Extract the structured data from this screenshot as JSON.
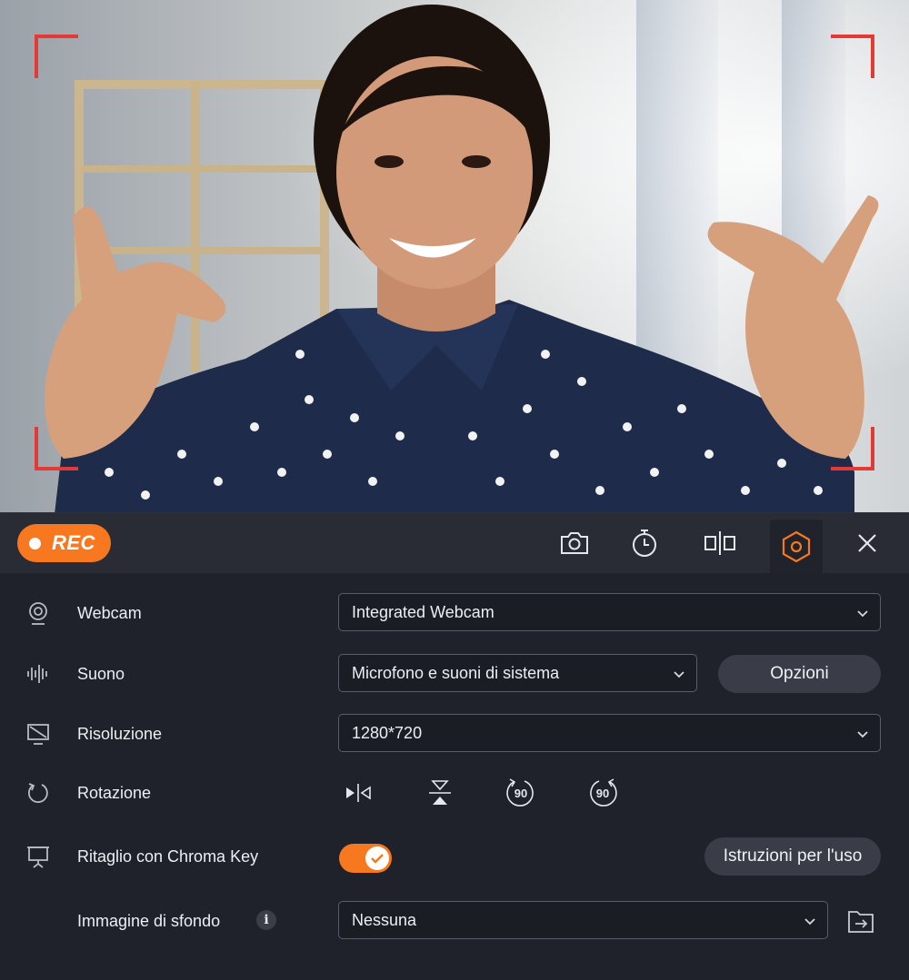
{
  "toolbar": {
    "rec_label": "REC",
    "icons": [
      "camera-icon",
      "timer-icon",
      "split-view-icon",
      "settings-icon",
      "close-icon"
    ],
    "accent_color": "#f7781f"
  },
  "webcam": {
    "label": "Webcam",
    "value": "Integrated Webcam"
  },
  "sound": {
    "label": "Suono",
    "value": "Microfono e suoni di sistema",
    "options_button": "Opzioni"
  },
  "resolution": {
    "label": "Risoluzione",
    "value": "1280*720"
  },
  "rotation": {
    "label": "Rotazione",
    "rotate_left_label": "90",
    "rotate_right_label": "90"
  },
  "chroma_key": {
    "label": "Ritaglio con Chroma Key",
    "enabled": true,
    "instructions_button": "Istruzioni per l'uso"
  },
  "background_image": {
    "label": "Immagine di sfondo",
    "value": "Nessuna"
  }
}
